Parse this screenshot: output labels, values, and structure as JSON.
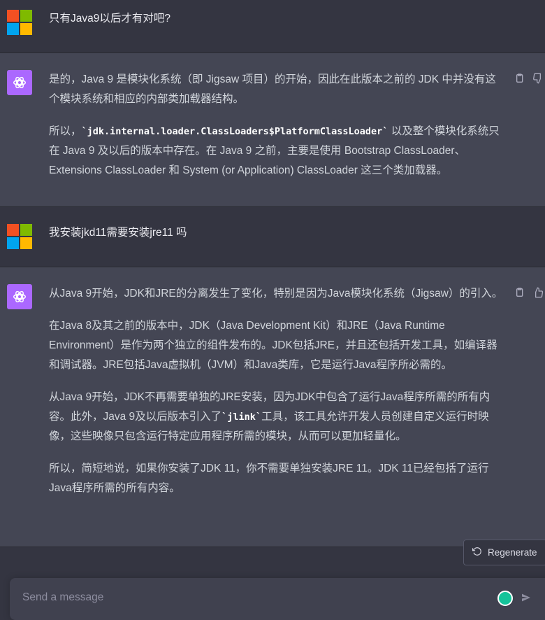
{
  "messages": [
    {
      "role": "user",
      "text": "只有Java9以后才有对吧?"
    },
    {
      "role": "assistant",
      "paragraphs": [
        {
          "parts": [
            {
              "t": "是的，Java 9 是模块化系统（即 Jigsaw 项目）的开始，因此在此版本之前的 JDK 中并没有这个模块系统和相应的内部类加载器结构。"
            }
          ]
        },
        {
          "parts": [
            {
              "t": "所以，"
            },
            {
              "code": "`jdk.internal.loader.ClassLoaders$PlatformClassLoader`"
            },
            {
              "t": " 以及整个模块化系统只在 Java 9 及以后的版本中存在。在 Java 9 之前，主要是使用 Bootstrap ClassLoader、Extensions ClassLoader 和 System (or Application) ClassLoader 这三个类加载器。"
            }
          ]
        }
      ]
    },
    {
      "role": "user",
      "text": "我安装jkd11需要安装jre11 吗"
    },
    {
      "role": "assistant",
      "paragraphs": [
        {
          "parts": [
            {
              "t": "从Java 9开始，JDK和JRE的分离发生了变化，特别是因为Java模块化系统（Jigsaw）的引入。"
            }
          ]
        },
        {
          "parts": [
            {
              "t": "在Java 8及其之前的版本中，JDK（Java Development Kit）和JRE（Java Runtime Environment）是作为两个独立的组件发布的。JDK包括JRE，并且还包括开发工具，如编译器和调试器。JRE包括Java虚拟机（JVM）和Java类库，它是运行Java程序所必需的。"
            }
          ]
        },
        {
          "parts": [
            {
              "t": "从Java 9开始，JDK不再需要单独的JRE安装，因为JDK中包含了运行Java程序所需的所有内容。此外，Java 9及以后版本引入了"
            },
            {
              "code": "`jlink`"
            },
            {
              "t": "工具，该工具允许开发人员创建自定义运行时映像，这些映像只包含运行特定应用程序所需的模块，从而可以更加轻量化。"
            }
          ]
        },
        {
          "parts": [
            {
              "t": "所以，简短地说，如果你安装了JDK 11，你不需要单独安装JRE 11。JDK 11已经包括了运行Java程序所需的所有内容。"
            }
          ]
        }
      ]
    }
  ],
  "regenerate_label": "Regenerate",
  "input": {
    "placeholder": "Send a message"
  },
  "colors": {
    "bg": "#343541",
    "assistant_bg": "#444654",
    "gpt_avatar": "#ab68ff"
  },
  "icons": [
    "microsoft-logo-icon",
    "openai-logo-icon",
    "copy-icon",
    "thumbs-down-icon",
    "thumbs-up-icon",
    "refresh-icon",
    "grammarly-icon",
    "send-icon"
  ]
}
